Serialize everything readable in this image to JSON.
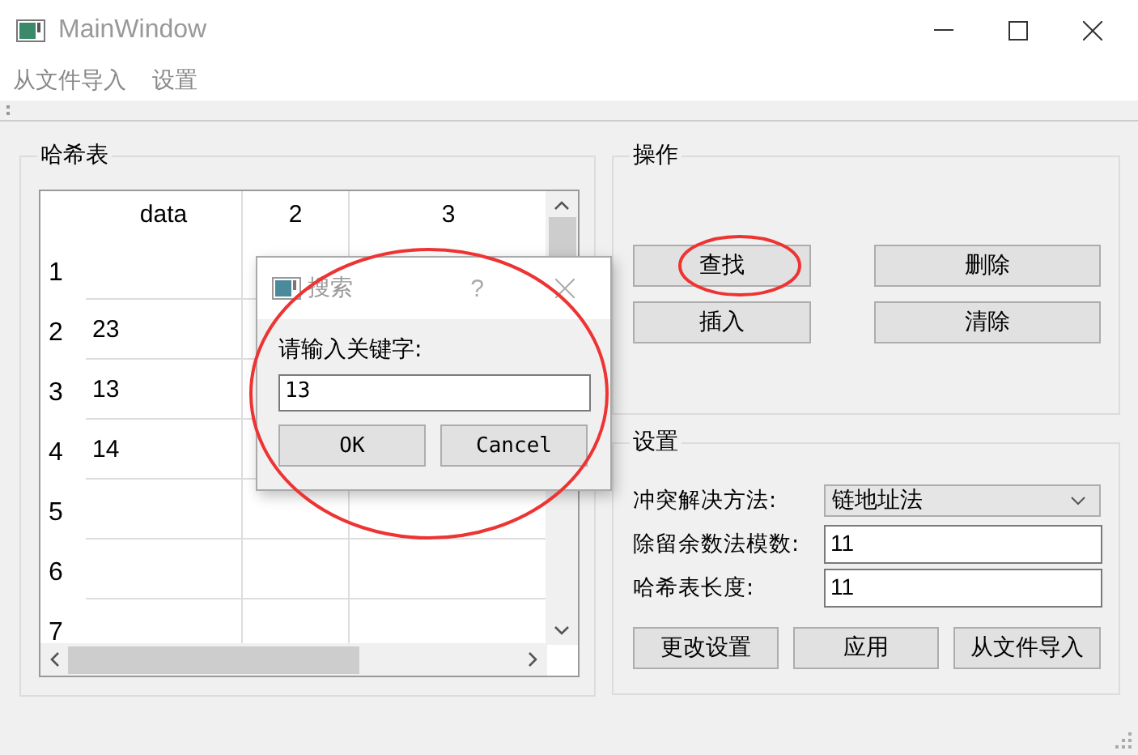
{
  "window": {
    "title": "MainWindow"
  },
  "menu": [
    {
      "label": "从文件导入"
    },
    {
      "label": "设置"
    }
  ],
  "hash_table": {
    "title": "哈希表",
    "columns": [
      "data",
      "2",
      "3"
    ],
    "rows": [
      {
        "header": "1"
      },
      {
        "header": "2",
        "values": [
          "23"
        ]
      },
      {
        "header": "3",
        "values": [
          "13"
        ]
      },
      {
        "header": "4",
        "values": [
          "14"
        ]
      },
      {
        "header": "5"
      },
      {
        "header": "6"
      },
      {
        "header": "7"
      }
    ]
  },
  "operations": {
    "title": "操作",
    "buttons": [
      "查找",
      "删除",
      "插入",
      "清除"
    ]
  },
  "settings": {
    "title": "设置",
    "fields": [
      {
        "kind": "select",
        "label": "冲突解决方法:",
        "value": "链地址法"
      },
      {
        "kind": "input",
        "label": "除留余数法模数:",
        "value": "11"
      },
      {
        "kind": "input",
        "label": "哈希表长度:",
        "value": "11"
      }
    ],
    "buttons": [
      "更改设置",
      "应用",
      "从文件导入"
    ]
  },
  "dialog": {
    "title": "搜索",
    "help": "?",
    "label": "请输入关键字:",
    "value": "13",
    "buttons": [
      "OK",
      "Cancel"
    ]
  }
}
